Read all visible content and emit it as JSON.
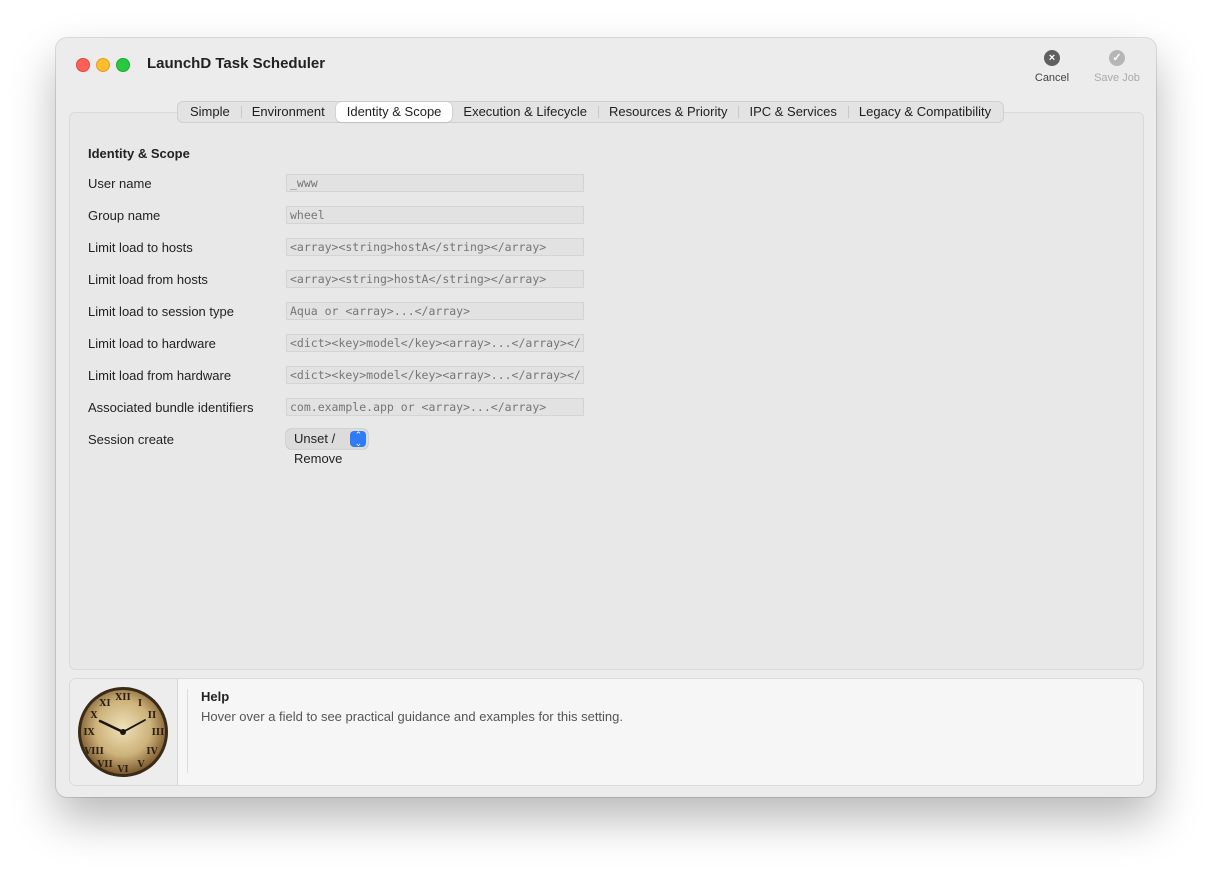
{
  "window": {
    "title": "LaunchD Task Scheduler"
  },
  "toolbar": {
    "cancel": {
      "label": "Cancel",
      "icon": "close-circle-icon"
    },
    "save": {
      "label": "Save Job",
      "icon": "checkmark-circle-icon"
    }
  },
  "tabs": [
    {
      "label": "Simple"
    },
    {
      "label": "Environment"
    },
    {
      "label": "Identity & Scope",
      "active": true
    },
    {
      "label": "Execution & Lifecycle"
    },
    {
      "label": "Resources & Priority"
    },
    {
      "label": "IPC & Services"
    },
    {
      "label": "Legacy & Compatibility"
    }
  ],
  "section": {
    "title": "Identity & Scope"
  },
  "fields": [
    {
      "label": "User name",
      "placeholder": "_www"
    },
    {
      "label": "Group name",
      "placeholder": "wheel"
    },
    {
      "label": "Limit load to hosts",
      "placeholder": "<array><string>hostA</string></array>"
    },
    {
      "label": "Limit load from hosts",
      "placeholder": "<array><string>hostA</string></array>"
    },
    {
      "label": "Limit load to session type",
      "placeholder": "Aqua or <array>...</array>"
    },
    {
      "label": "Limit load to hardware",
      "placeholder": "<dict><key>model</key><array>...</array></dict>"
    },
    {
      "label": "Limit load from hardware",
      "placeholder": "<dict><key>model</key><array>...</array></dict>"
    },
    {
      "label": "Associated bundle identifiers",
      "placeholder": "com.example.app or <array>...</array>"
    }
  ],
  "session_create": {
    "label": "Session create",
    "value": "Unset / Remove"
  },
  "help": {
    "title": "Help",
    "text": "Hover over a field to see practical guidance and examples for this setting.",
    "image": "vintage-wall-clock-icon"
  },
  "colors": {
    "window_bg": "#ececec",
    "accent": "#2f7bf5",
    "traffic_close": "#fe5f57",
    "traffic_minimize": "#febc2e",
    "traffic_zoom": "#28c840"
  }
}
